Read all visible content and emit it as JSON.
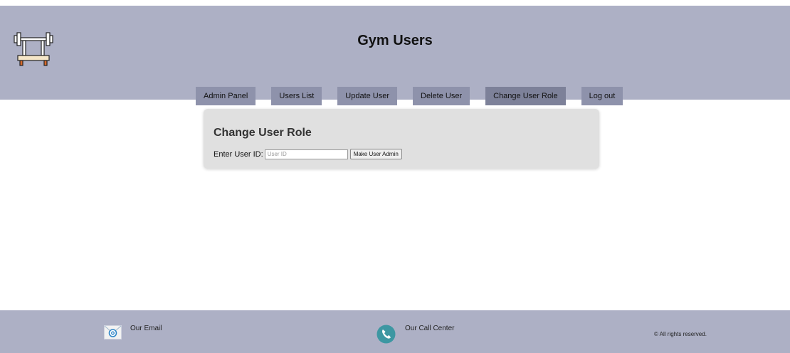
{
  "header": {
    "title": "Gym Users"
  },
  "nav": {
    "items": [
      "Admin Panel",
      "Users List",
      "Update User",
      "Delete User",
      "Change User Role",
      "Log out"
    ],
    "active_index": 4
  },
  "card": {
    "title": "Change User Role",
    "field_label": "Enter User ID:",
    "field_placeholder": "User ID",
    "field_value": "",
    "button_label": "Make User Admin"
  },
  "footer": {
    "email_label": "Our Email",
    "call_label": "Our Call Center",
    "copyright": "© All rights reserved."
  },
  "icons": {
    "logo": "barbell-bench-icon",
    "email": "email-at-icon",
    "phone": "phone-icon"
  },
  "colors": {
    "header_bg": "#adb0c5",
    "nav_button_bg": "#8e92ab",
    "card_bg": "#e0e0e0",
    "phone_icon": "#3d97a2"
  }
}
